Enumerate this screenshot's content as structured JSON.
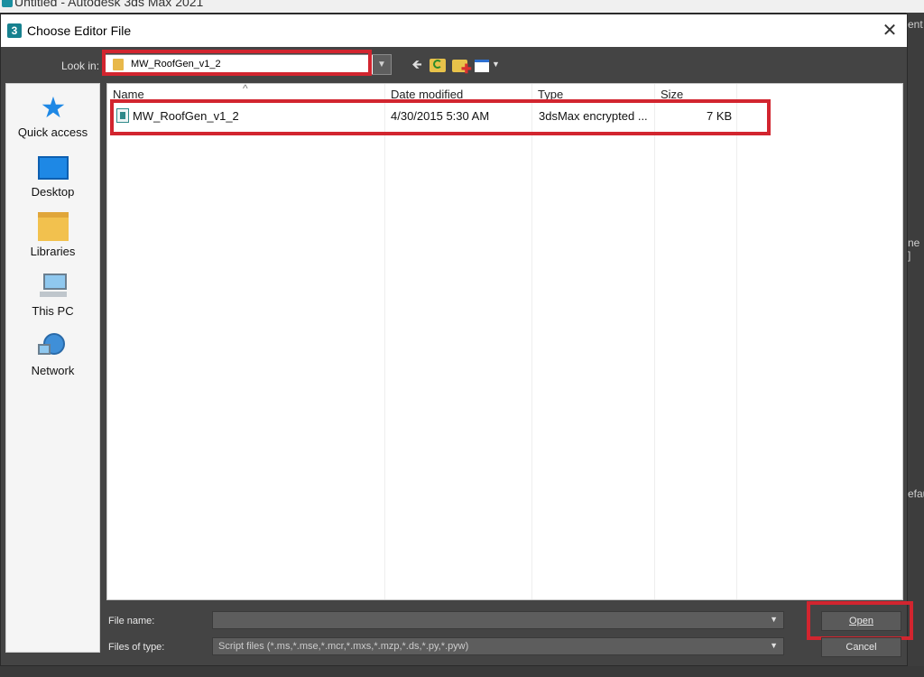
{
  "app": {
    "title": "Untitled - Autodesk 3ds Max 2021",
    "right_fragments": [
      "ent",
      "ne ]",
      "efau"
    ]
  },
  "dialog": {
    "title": "Choose Editor File",
    "icon_glyph": "3",
    "close_glyph": "✕"
  },
  "toolbar": {
    "look_in_label": "Look in:",
    "look_in_value": "MW_RoofGen_v1_2",
    "back_glyph": "🡸"
  },
  "places": [
    {
      "label": "Quick access",
      "icon": "star-icon"
    },
    {
      "label": "Desktop",
      "icon": "desktop-icon"
    },
    {
      "label": "Libraries",
      "icon": "libraries-icon"
    },
    {
      "label": "This PC",
      "icon": "computer-icon"
    },
    {
      "label": "Network",
      "icon": "network-icon"
    }
  ],
  "file_list": {
    "columns": [
      "Name",
      "Date modified",
      "Type",
      "Size"
    ],
    "sort_glyph": "^",
    "rows": [
      {
        "name": "MW_RoofGen_v1_2",
        "date": "4/30/2015 5:30 AM",
        "type": "3dsMax encrypted ...",
        "size": "7 KB"
      }
    ]
  },
  "bottom": {
    "file_name_label": "File name:",
    "file_name_value": "",
    "files_of_type_label": "Files of type:",
    "files_of_type_value": "Script files (*.ms,*.mse,*.mcr,*.mxs,*.mzp,*.ds,*.py,*.pyw)",
    "open_label": "Open",
    "cancel_label": "Cancel"
  },
  "colors": {
    "highlight": "#d2252f",
    "dialog_bg": "#444444",
    "accent": "#1e88e5"
  }
}
